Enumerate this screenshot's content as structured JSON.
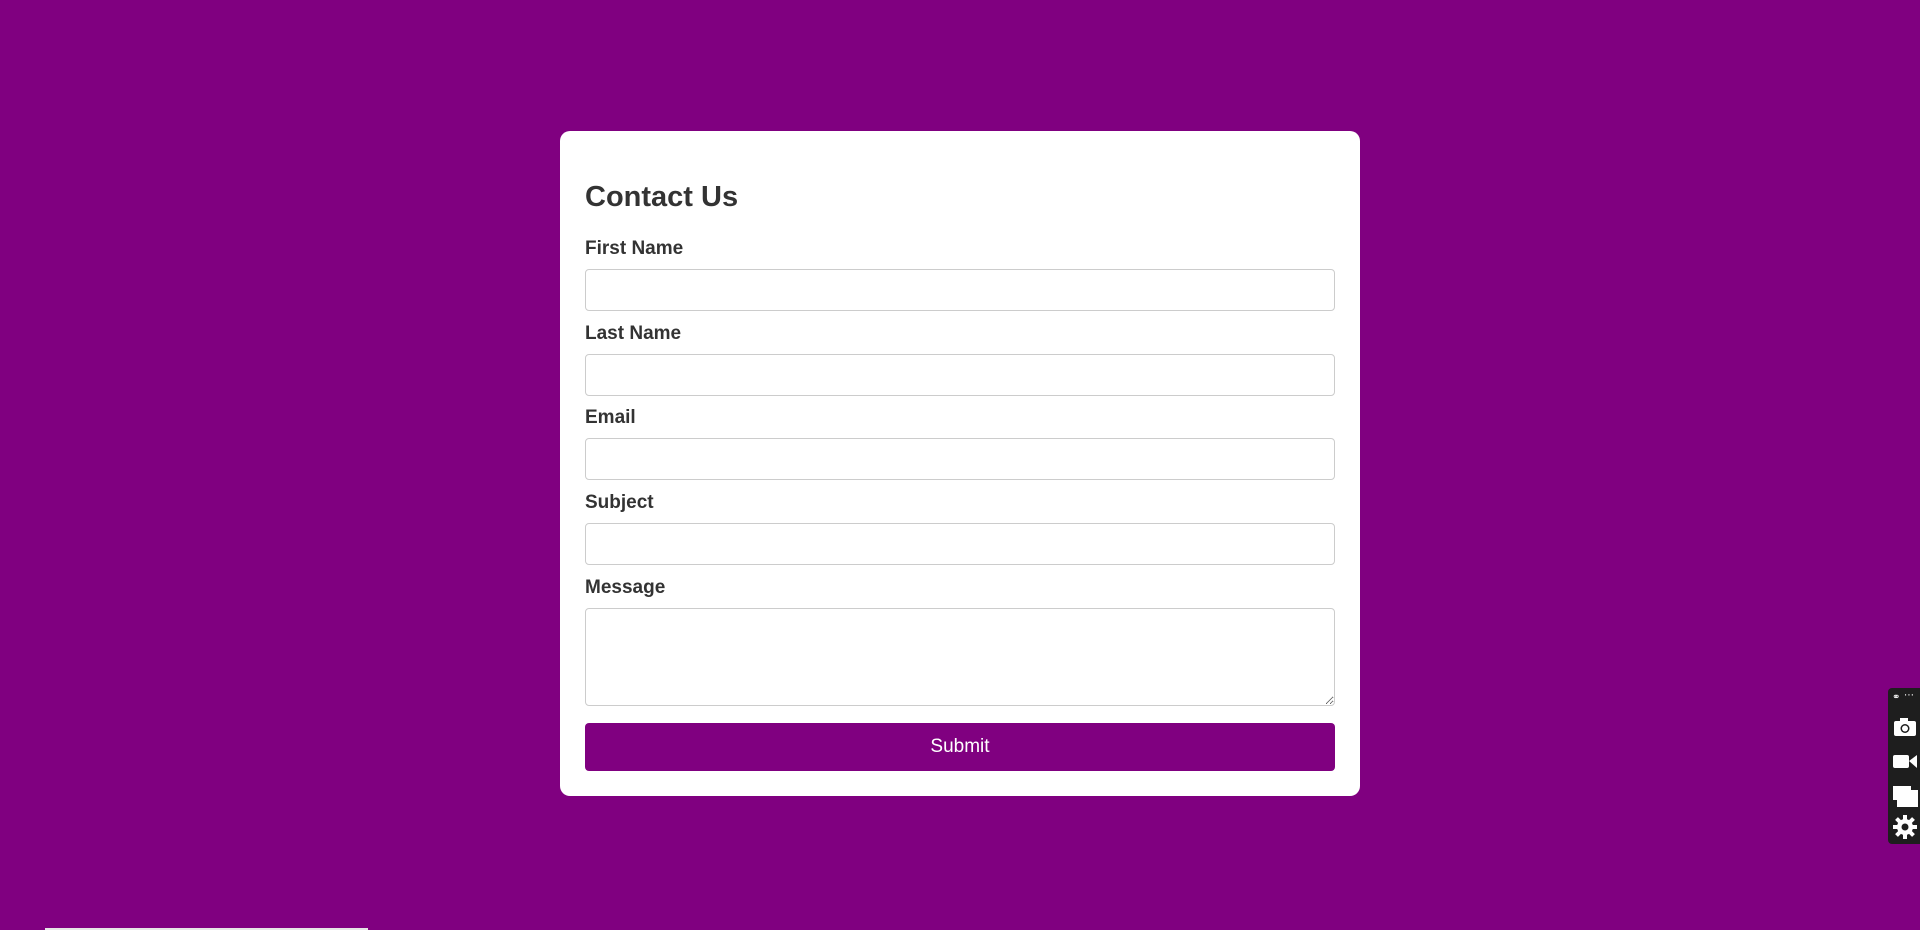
{
  "form": {
    "title": "Contact Us",
    "fields": [
      {
        "label": "First Name",
        "value": "",
        "placeholder": ""
      },
      {
        "label": "Last Name",
        "value": "",
        "placeholder": ""
      },
      {
        "label": "Email",
        "value": "",
        "placeholder": ""
      },
      {
        "label": "Subject",
        "value": "",
        "placeholder": ""
      },
      {
        "label": "Message",
        "value": "",
        "placeholder": ""
      }
    ],
    "submit_label": "Submit"
  },
  "toolbar": {
    "icons": [
      "link-icon",
      "more-icon",
      "camera-icon",
      "video-icon",
      "window-icon",
      "gear-icon"
    ]
  },
  "colors": {
    "background": "#800080",
    "card": "#ffffff",
    "accent": "#800080",
    "text": "#333333"
  }
}
